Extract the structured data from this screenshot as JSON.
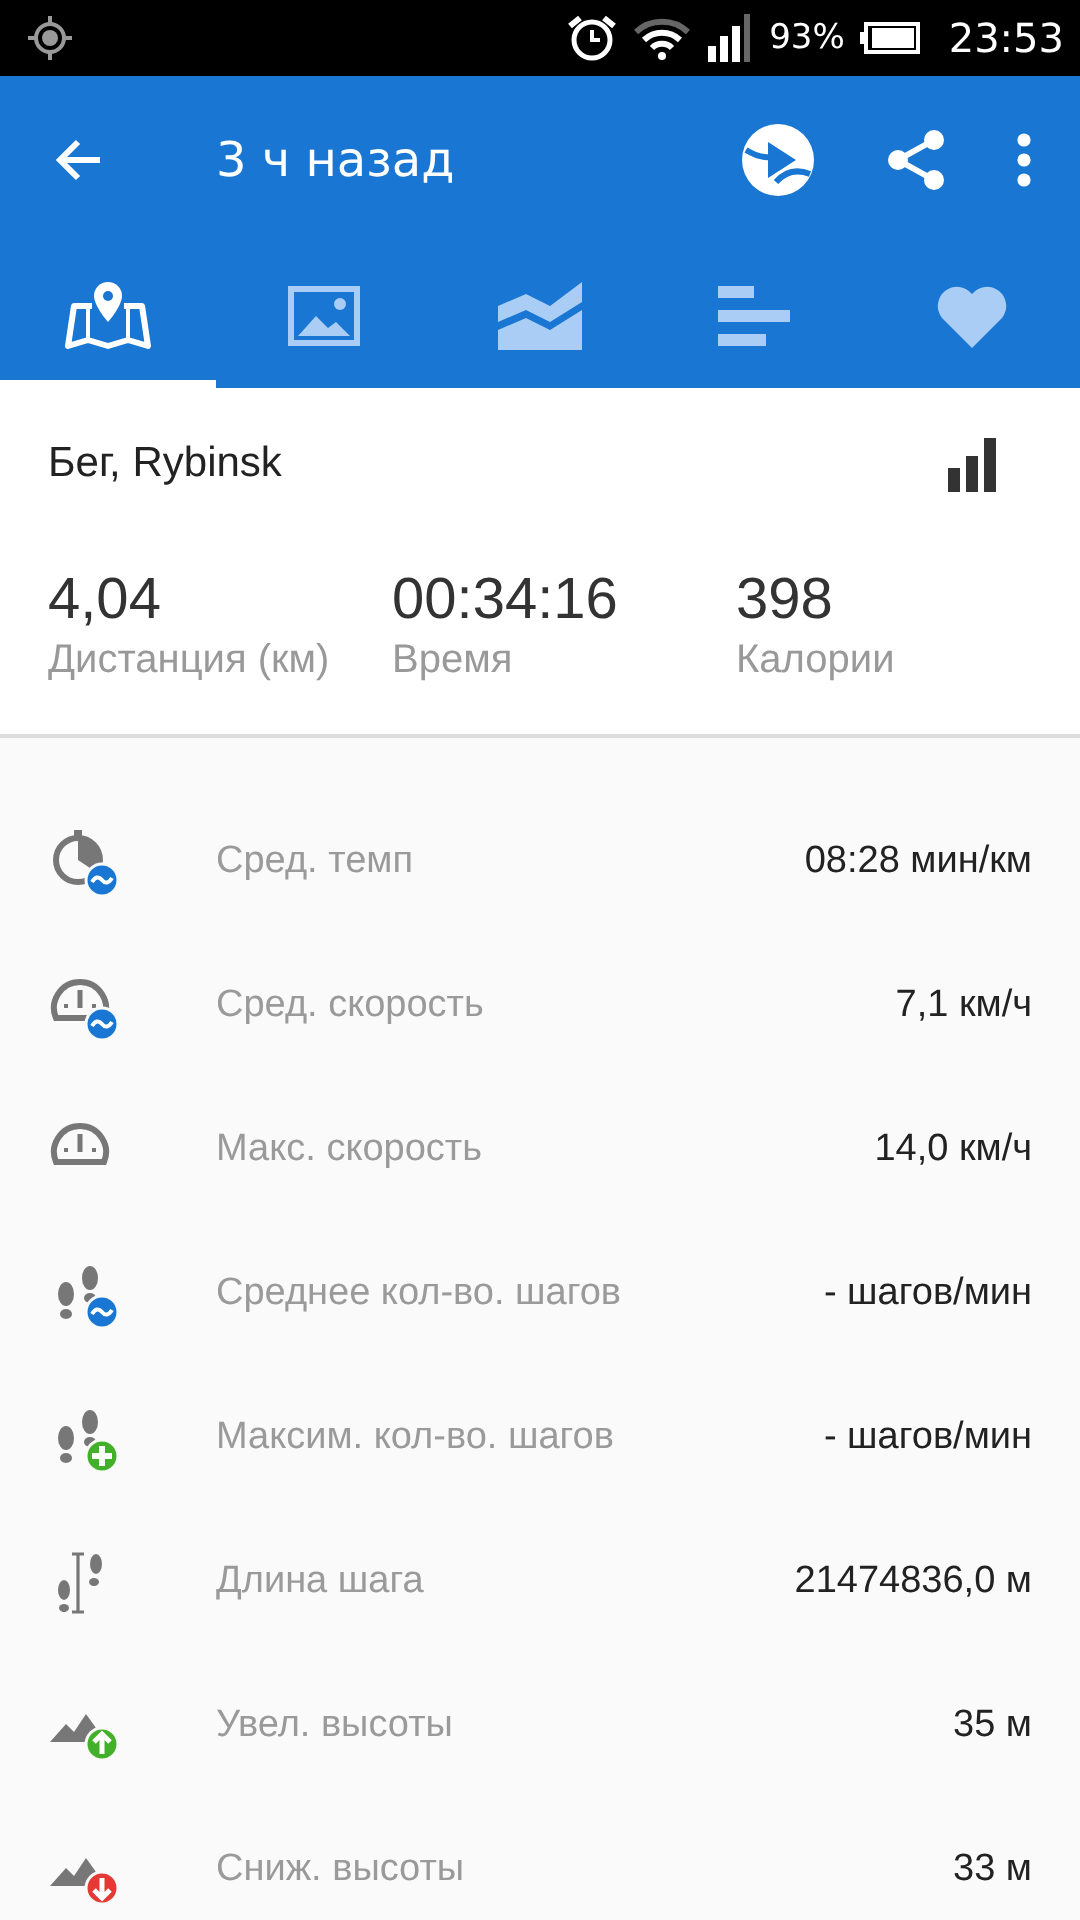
{
  "status_bar": {
    "battery": "93%",
    "time": "23:53"
  },
  "app_bar": {
    "title": "3 ч назад"
  },
  "tabs": [
    {
      "kind": "map",
      "selected": true
    },
    {
      "kind": "photos",
      "selected": false
    },
    {
      "kind": "chart",
      "selected": false
    },
    {
      "kind": "splits",
      "selected": false
    },
    {
      "kind": "heart",
      "selected": false
    }
  ],
  "activity": {
    "title": "Бег, Rybinsk"
  },
  "summary": [
    {
      "value": "4,04",
      "label": "Дистанция (км)"
    },
    {
      "value": "00:34:16",
      "label": "Время"
    },
    {
      "value": "398",
      "label": "Калории"
    }
  ],
  "metrics": [
    {
      "kind": "pace",
      "label": "Сред. темп",
      "value": "08:28 мин/км"
    },
    {
      "kind": "speed",
      "label": "Сред. скорость",
      "value": "7,1 км/ч"
    },
    {
      "kind": "max-speed",
      "label": "Макс. скорость",
      "value": "14,0 км/ч"
    },
    {
      "kind": "steps-avg",
      "label": "Среднее кол-во. шагов",
      "value": "- шагов/мин"
    },
    {
      "kind": "steps-max",
      "label": "Максим. кол-во. шагов",
      "value": "- шагов/мин"
    },
    {
      "kind": "stride",
      "label": "Длина шага",
      "value": "21474836,0 м"
    },
    {
      "kind": "ascent",
      "label": "Увел. высоты",
      "value": "35 м"
    },
    {
      "kind": "descent",
      "label": "Сниж. высоты",
      "value": "33 м"
    }
  ]
}
